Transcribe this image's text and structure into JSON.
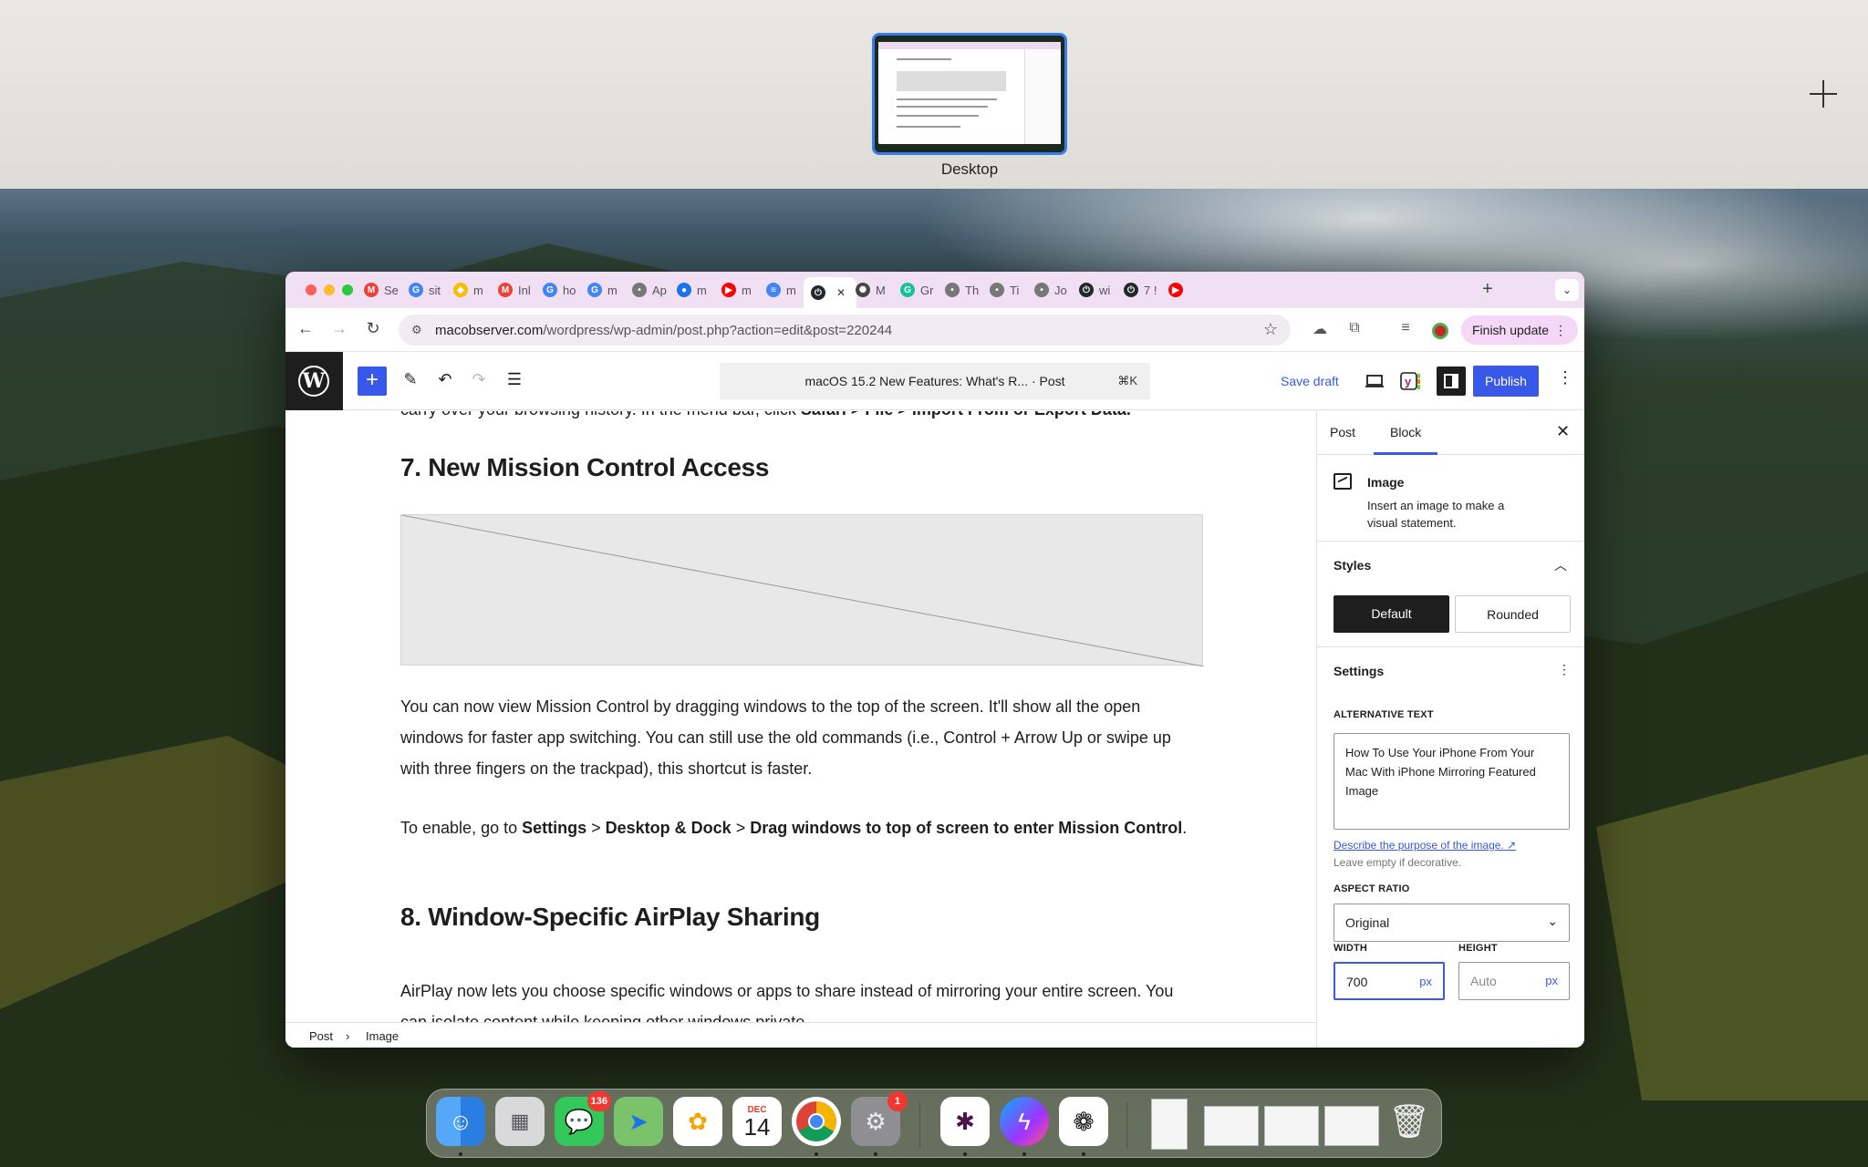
{
  "desktop": {
    "space_label": "Desktop"
  },
  "browser": {
    "tabs": [
      {
        "label": "Se",
        "icon": "gmail-icon"
      },
      {
        "label": "sit",
        "icon": "google-icon"
      },
      {
        "label": "m",
        "icon": "google-cloud-icon"
      },
      {
        "label": "Inl",
        "icon": "gmail-icon"
      },
      {
        "label": "ho",
        "icon": "google-icon"
      },
      {
        "label": "m",
        "icon": "google-icon"
      },
      {
        "label": "Ap",
        "icon": "site-icon"
      },
      {
        "label": "m",
        "icon": "apple-icon"
      },
      {
        "label": "m",
        "icon": "youtube-icon"
      },
      {
        "label": "m",
        "icon": "docs-icon"
      },
      {
        "label": "",
        "icon": "wordpress-power-icon"
      },
      {
        "label": "M",
        "icon": "chatgpt-icon"
      },
      {
        "label": "Gr",
        "icon": "grammarly-icon"
      },
      {
        "label": "Th",
        "icon": "site-icon"
      },
      {
        "label": "Ti",
        "icon": "site-icon"
      },
      {
        "label": "Jo",
        "icon": "site-icon"
      },
      {
        "label": "wi",
        "icon": "wordpress-power-icon"
      },
      {
        "label": "7 !",
        "icon": "wordpress-power-icon"
      },
      {
        "label": "",
        "icon": "youtube-icon"
      }
    ],
    "url_domain": "macobserver.com",
    "url_path": "/wordpress/wp-admin/post.php?action=edit&post=220244",
    "finish_update_label": "Finish update"
  },
  "editor": {
    "doc_title": "macOS 15.2 New Features: What's R...",
    "doc_type": "· Post",
    "shortcut": "⌘K",
    "save_draft_label": "Save draft",
    "publish_label": "Publish",
    "content": {
      "clipped_prefix": "carry over your browsing history. In the menu bar, click ",
      "clipped_bold": "Safari > File > Import From or Export Data.",
      "heading_7": "7. New Mission Control Access",
      "para_1": "You can now view Mission Control by dragging windows to the top of the screen. It'll show all the open windows for faster app switching. You can still use the old commands (i.e., Control + Arrow Up or swipe up with three fingers on the trackpad), this shortcut is faster.",
      "para_2_prefix": "To enable, go to ",
      "para_2_b1": "Settings",
      "para_2_sep1": " > ",
      "para_2_b2": "Desktop & Dock",
      "para_2_sep2": " > ",
      "para_2_b3": "Drag windows to top of screen to enter Mission Control",
      "para_2_suffix": ".",
      "heading_8": "8. Window-Specific AirPlay Sharing",
      "para_3": "AirPlay now lets you choose specific windows or apps to share instead of mirroring your entire screen. You can isolate content while keeping other windows private."
    },
    "breadcrumb": [
      "Post",
      "Image"
    ]
  },
  "sidebar": {
    "tab_post": "Post",
    "tab_block": "Block",
    "block_name": "Image",
    "block_desc": "Insert an image to make a visual statement.",
    "styles_title": "Styles",
    "style_default": "Default",
    "style_rounded": "Rounded",
    "settings_title": "Settings",
    "alt_label": "ALTERNATIVE TEXT",
    "alt_value": "How To Use Your iPhone From Your Mac With iPhone Mirroring Featured Image",
    "describe_link": "Describe the purpose of the image.",
    "describe_help": "Leave empty if decorative.",
    "aspect_label": "ASPECT RATIO",
    "aspect_value": "Original",
    "width_label": "WIDTH",
    "width_value": "700",
    "height_label": "HEIGHT",
    "height_placeholder": "Auto",
    "unit": "px"
  },
  "dock": {
    "messages_badge": "136",
    "calendar_month": "DEC",
    "calendar_day": "14",
    "settings_badge": "1"
  },
  "colors": {
    "wp_blue": "#3858e9",
    "tab_bar": "#f1dff3",
    "selection_border": "#3a7bf0"
  }
}
